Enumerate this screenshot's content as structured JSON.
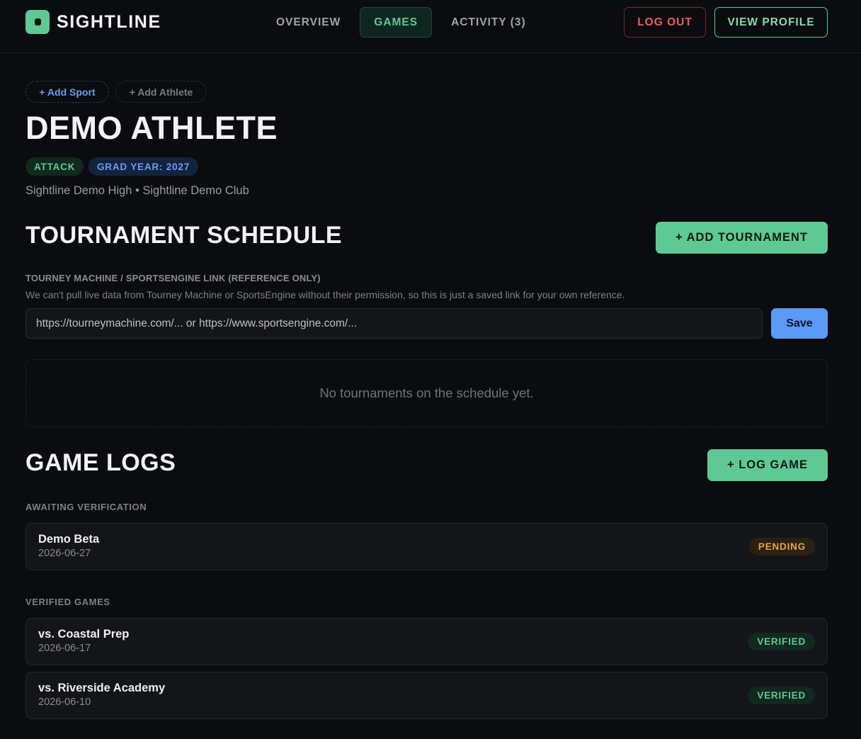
{
  "brand": {
    "name": "SIGHTLINE",
    "accent": "#5ec994"
  },
  "nav": {
    "tabs": [
      {
        "label": "OVERVIEW",
        "active": false
      },
      {
        "label": "GAMES",
        "active": true
      },
      {
        "label": "ACTIVITY (3)",
        "active": false
      }
    ]
  },
  "header_actions": {
    "logout": "LOG OUT",
    "view_profile": "VIEW PROFILE"
  },
  "chips": {
    "add_sport": "+ Add Sport",
    "add_athlete": "+ Add Athlete"
  },
  "athlete": {
    "name": "DEMO ATHLETE",
    "position": "ATTACK",
    "grad_year": "GRAD YEAR: 2027",
    "schools": "Sightline Demo High • Sightline Demo Club"
  },
  "tournament": {
    "title": "TOURNAMENT SCHEDULE",
    "add_button": "+ ADD TOURNAMENT",
    "link_label": "TOURNEY MACHINE / SPORTSENGINE LINK (REFERENCE ONLY)",
    "link_help": "We can't pull live data from Tourney Machine or SportsEngine without their permission, so this is just a saved link for your own reference.",
    "link_placeholder": "https://tourneymachine.com/... or https://www.sportsengine.com/...",
    "save": "Save",
    "empty": "No tournaments on the schedule yet."
  },
  "game_logs": {
    "title": "GAME LOGS",
    "log_button": "+ LOG GAME",
    "awaiting_label": "AWAITING VERIFICATION",
    "awaiting": [
      {
        "title": "Demo Beta",
        "date": "2026-06-27",
        "status": "PENDING"
      }
    ],
    "verified_label": "VERIFIED GAMES",
    "verified": [
      {
        "title": "vs. Coastal Prep",
        "date": "2026-06-17",
        "status": "VERIFIED"
      },
      {
        "title": "vs. Riverside Academy",
        "date": "2026-06-10",
        "status": "VERIFIED"
      }
    ]
  }
}
